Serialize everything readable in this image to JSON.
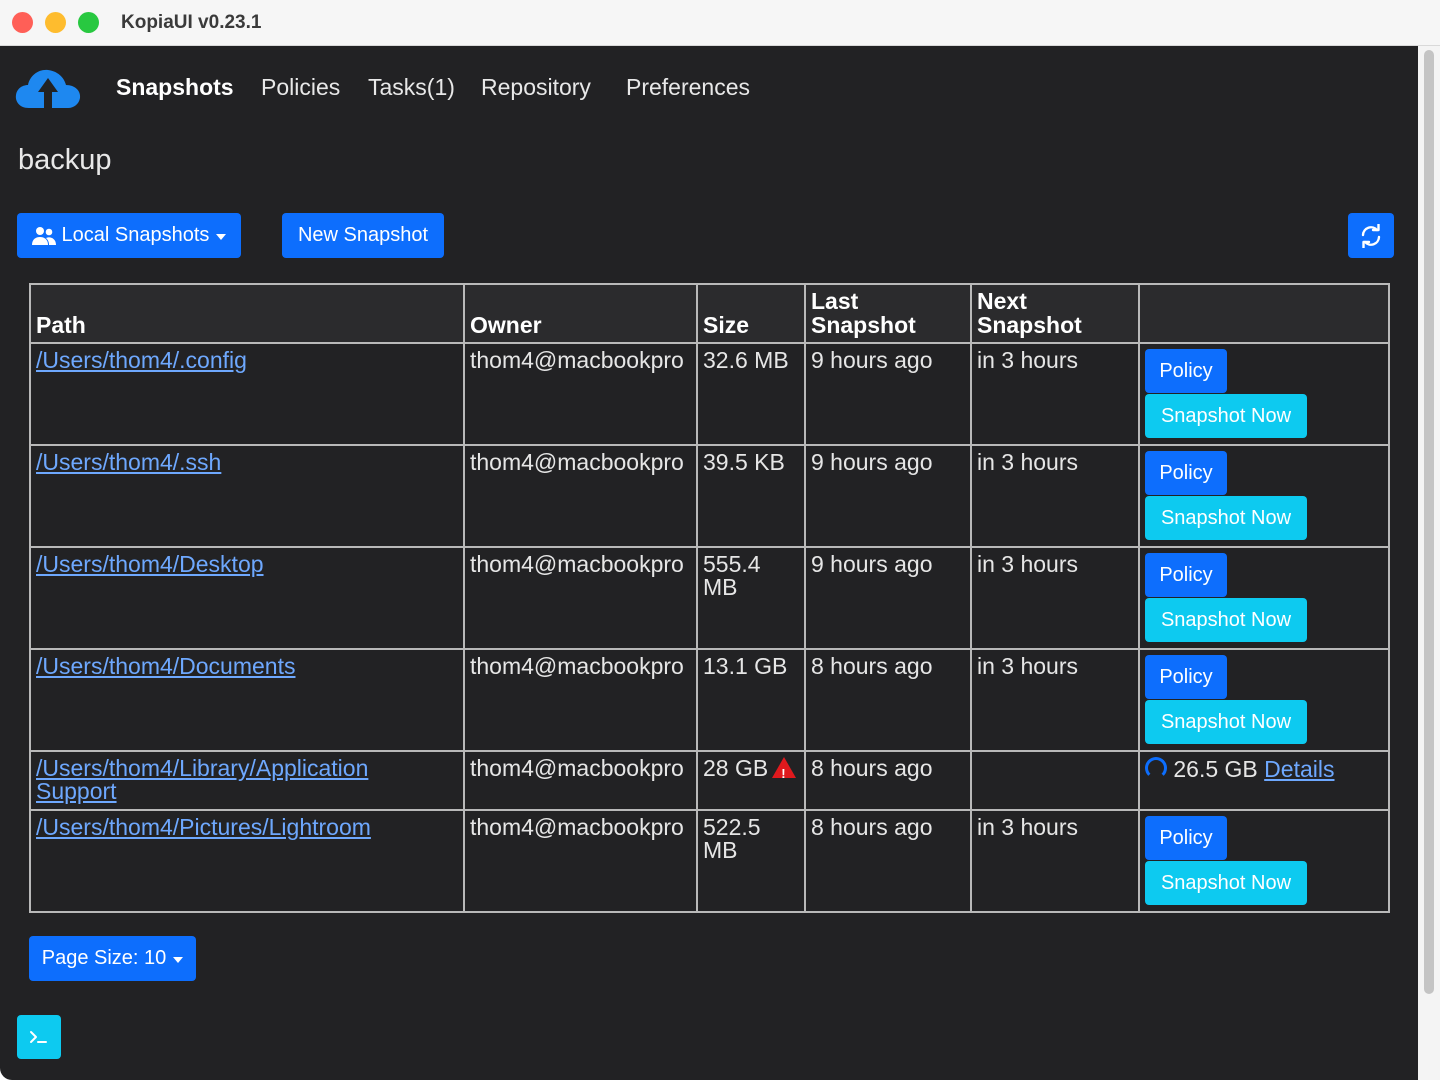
{
  "window": {
    "title": "KopiaUI v0.23.1"
  },
  "nav": {
    "items": [
      {
        "label": "Snapshots",
        "active": true
      },
      {
        "label": "Policies",
        "active": false
      },
      {
        "label": "Tasks(1)",
        "active": false
      },
      {
        "label": "Repository",
        "active": false
      },
      {
        "label": "Preferences",
        "active": false
      }
    ]
  },
  "page": {
    "title": "backup"
  },
  "toolbar": {
    "local_snapshots_label": "Local Snapshots",
    "new_snapshot_label": "New Snapshot",
    "refresh_icon": "refresh-icon"
  },
  "table": {
    "headers": {
      "path": "Path",
      "owner": "Owner",
      "size": "Size",
      "last_line1": "Last",
      "last_line2": "Snapshot",
      "next_line1": "Next",
      "next_line2": "Snapshot"
    },
    "policy_label": "Policy",
    "snapshot_now_label": "Snapshot Now",
    "rows": [
      {
        "path": "/Users/thom4/.config",
        "owner": "thom4@macbookpro",
        "size": "32.6 MB",
        "last": "9 hours ago",
        "next": "in 3 hours"
      },
      {
        "path": "/Users/thom4/.ssh",
        "owner": "thom4@macbookpro",
        "size": "39.5 KB",
        "last": "9 hours ago",
        "next": "in 3 hours"
      },
      {
        "path": "/Users/thom4/Desktop",
        "owner": "thom4@macbookpro",
        "size_line1": "555.4",
        "size_line2": "MB",
        "last": "9 hours ago",
        "next": "in 3 hours"
      },
      {
        "path": "/Users/thom4/Documents",
        "owner": "thom4@macbookpro",
        "size": "13.1 GB",
        "last": "8 hours ago",
        "next": "in 3 hours"
      },
      {
        "path_line1": "/Users/thom4/Library/Application",
        "path_line2": "Support",
        "owner": "thom4@macbookpro",
        "size": "28 GB",
        "size_warning": true,
        "last": "8 hours ago",
        "next": "",
        "progress": "26.5 GB",
        "details_label": "Details"
      },
      {
        "path": "/Users/thom4/Pictures/Lightroom",
        "owner": "thom4@macbookpro",
        "size_line1": "522.5",
        "size_line2": "MB",
        "last": "8 hours ago",
        "next": "in 3 hours"
      }
    ]
  },
  "footer": {
    "page_size_label": "Page Size: 10",
    "terminal_icon": "terminal-icon"
  },
  "colors": {
    "primary": "#0d6efd",
    "info": "#0dcaf0",
    "link": "#6ea8fe",
    "background": "#222224",
    "warning": "#e0191d"
  }
}
